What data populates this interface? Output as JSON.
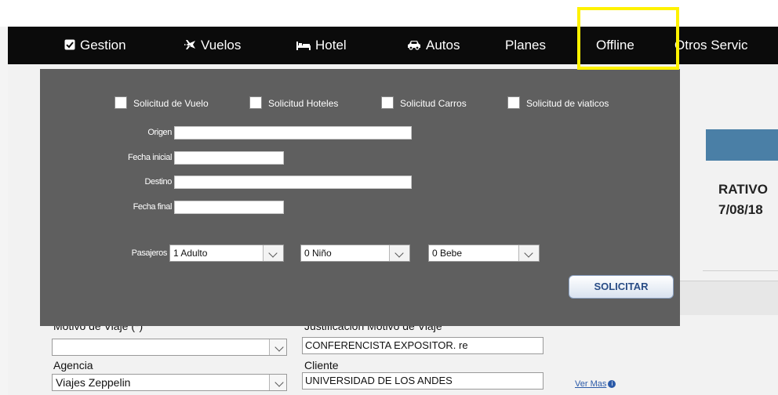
{
  "nav": {
    "items": [
      {
        "label": "Gestion",
        "icon": "check-square-icon"
      },
      {
        "label": "Vuelos",
        "icon": "plane-icon"
      },
      {
        "label": "Hotel",
        "icon": "bed-icon"
      },
      {
        "label": "Autos",
        "icon": "car-icon"
      },
      {
        "label": "Planes",
        "icon": ""
      },
      {
        "label": "Offline",
        "icon": ""
      },
      {
        "label": "Otros Servic",
        "icon": ""
      }
    ],
    "highlight_color": "#fff200"
  },
  "offline_panel": {
    "checkboxes": [
      {
        "label": "Solicitud de Vuelo",
        "checked": false
      },
      {
        "label": "Solicitud Hoteles",
        "checked": false
      },
      {
        "label": "Solicitud Carros",
        "checked": false
      },
      {
        "label": "Solicitud de viaticos",
        "checked": false
      }
    ],
    "fields": {
      "origen_label": "Origen",
      "origen_value": "",
      "fecha_inicial_label": "Fecha inicial",
      "fecha_inicial_value": "",
      "destino_label": "Destino",
      "destino_value": "",
      "fecha_final_label": "Fecha final",
      "fecha_final_value": ""
    },
    "pasajeros": {
      "label": "Pasajeros",
      "adultos": "1 Adulto",
      "ninos": "0 Niño",
      "bebes": "0 Bebe"
    },
    "submit_label": "SOLICITAR",
    "background": "#5f5f5f"
  },
  "background_page": {
    "partial_heading_1": "RATIVO",
    "partial_heading_2": "7/08/18",
    "motivo_label": "Motivo de Viaje (*)",
    "motivo_value": "",
    "justificacion_label": "Justificación Motivo de Viaje",
    "justificacion_value": "CONFERENCISTA  EXPOSITOR. re",
    "agencia_label": "Agencia",
    "agencia_value": "Viajes Zeppelin",
    "cliente_label": "Cliente",
    "cliente_value": "UNIVERSIDAD DE LOS ANDES",
    "ver_mas": "Ver Mas",
    "info_glyph": "i"
  }
}
